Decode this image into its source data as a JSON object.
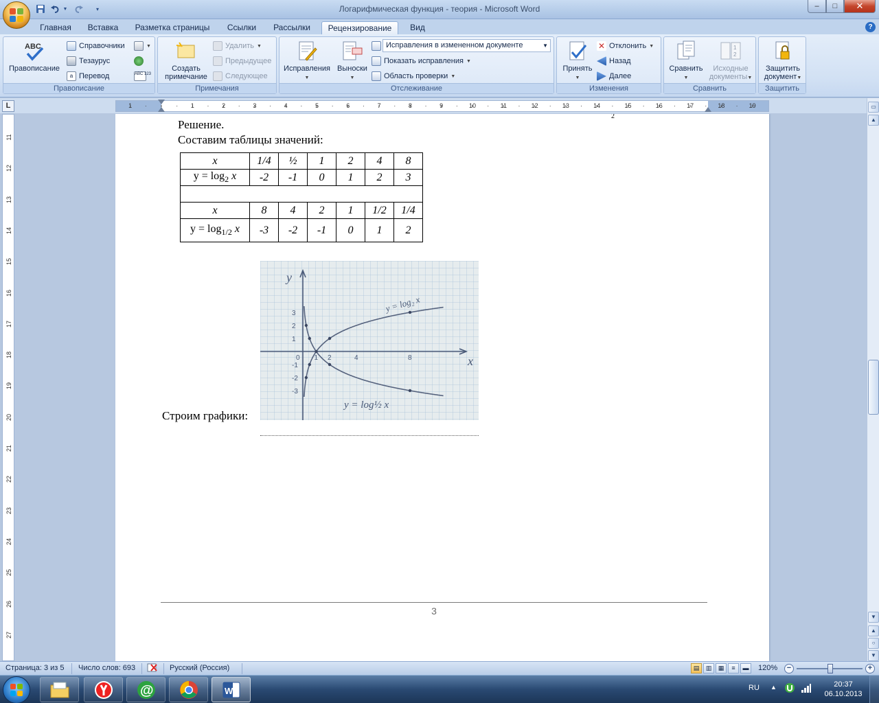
{
  "window": {
    "title": "Логарифмическая функция - теория - Microsoft Word",
    "min_glyph": "–",
    "max_glyph": "□",
    "close_glyph": "✕"
  },
  "tabs": [
    {
      "label": "Главная"
    },
    {
      "label": "Вставка"
    },
    {
      "label": "Разметка страницы"
    },
    {
      "label": "Ссылки"
    },
    {
      "label": "Рассылки"
    },
    {
      "label": "Рецензирование",
      "active": true
    },
    {
      "label": "Вид"
    }
  ],
  "ribbon": {
    "proofing": {
      "label": "Правописание",
      "spelling": "Правописание",
      "spelling_icon_text": "ABC",
      "research": "Справочники",
      "thesaurus": "Тезаурус",
      "translate": "Перевод",
      "count_icon_text": "ABC 123"
    },
    "comments": {
      "label": "Примечания",
      "new_line1": "Создать",
      "new_line2": "примечание",
      "delete": "Удалить",
      "previous": "Предыдущее",
      "next": "Следующее"
    },
    "tracking": {
      "label": "Отслеживание",
      "track_changes": "Исправления",
      "balloons": "Выноски",
      "display_for_review": "Исправления в измененном документе",
      "show_markup": "Показать исправления",
      "reviewing_pane": "Область проверки"
    },
    "changes": {
      "label": "Изменения",
      "accept": "Принять",
      "reject": "Отклонить",
      "previous": "Назад",
      "next": "Далее"
    },
    "compare": {
      "label": "Сравнить",
      "compare": "Сравнить",
      "source_line1": "Исходные",
      "source_line2": "документы"
    },
    "protect": {
      "label": "Защитить",
      "protect_line1": "Защитить",
      "protect_line2": "документ"
    }
  },
  "ruler": {
    "corner": "L",
    "h_labels": [
      "1",
      "1",
      "2",
      "3",
      "4",
      "5",
      "6",
      "7",
      "8",
      "9",
      "10",
      "11",
      "12",
      "13",
      "14",
      "15",
      "16",
      "17",
      "18",
      "19"
    ],
    "v_labels": [
      "11",
      "12",
      "13",
      "14",
      "15",
      "16",
      "17",
      "18",
      "19",
      "20",
      "21",
      "22",
      "23",
      "24",
      "25",
      "26",
      "27"
    ]
  },
  "document": {
    "stray_sub": "2",
    "solution": "Решение.",
    "tables_intro": "Составим таблицы значений:",
    "table1": {
      "head_x": "x",
      "x_values": [
        "1/4",
        "½",
        "1",
        "2",
        "4",
        "8"
      ],
      "y_label_prefix": "y = log",
      "y_label_base": "2",
      "y_label_var": "x",
      "y_values": [
        "-2",
        "-1",
        "0",
        "1",
        "2",
        "3"
      ]
    },
    "table2": {
      "head_x": "x",
      "x_values": [
        "8",
        "4",
        "2",
        "1",
        "1/2",
        "1/4"
      ],
      "y_label_prefix": "y = log",
      "y_label_base": "1/2",
      "y_label_var": "x",
      "y_values": [
        "-3",
        "-2",
        "-1",
        "0",
        "1",
        "2"
      ]
    },
    "graph": {
      "axis_x": "x",
      "axis_y": "y",
      "label_up": "y = log₂ x",
      "label_down": "y = log½ x",
      "x_ticks": [
        "0",
        "1",
        "2",
        "4",
        "8"
      ],
      "y_ticks": [
        "3",
        "2",
        "1",
        "-1",
        "-2",
        "-3"
      ]
    },
    "plot_caption": "Строим графики:",
    "page_number": "3"
  },
  "statusbar": {
    "page": "Страница: 3 из 5",
    "words": "Число слов: 693",
    "language": "Русский (Россия)",
    "zoom": "120%",
    "zoom_minus": "−",
    "zoom_plus": "+"
  },
  "taskbar": {
    "lang": "RU",
    "time": "20:37",
    "date": "06.10.2013",
    "mail_glyph": "@",
    "word_glyph": "W"
  },
  "colors": {
    "accent": "#2b579a",
    "ribbon": "#dbe7f7",
    "close": "#c4462c"
  }
}
